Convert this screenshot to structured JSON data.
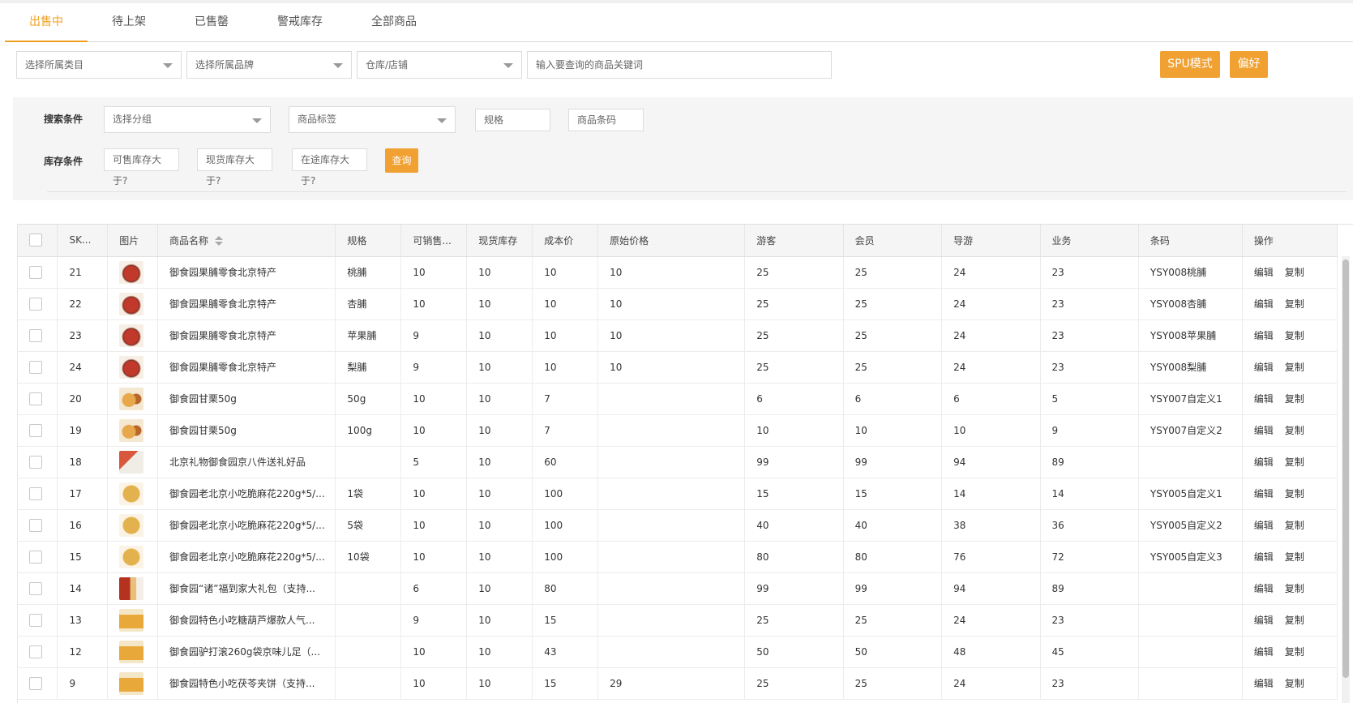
{
  "tabs": [
    {
      "label": "出售中",
      "active": true
    },
    {
      "label": "待上架",
      "active": false
    },
    {
      "label": "已售罄",
      "active": false
    },
    {
      "label": "警戒库存",
      "active": false
    },
    {
      "label": "全部商品",
      "active": false
    }
  ],
  "filters": {
    "category": "选择所属类目",
    "brand": "选择所属品牌",
    "warehouse": "仓库/店铺",
    "keyword_placeholder": "输入要查询的商品关键词"
  },
  "buttons": {
    "spu_mode": "SPU模式",
    "preference": "偏好",
    "query": "查询"
  },
  "search_conditions": {
    "label": "搜索条件",
    "group": "选择分组",
    "tag": "商品标签",
    "spec": "规格",
    "barcode": "商品条码"
  },
  "stock_conditions": {
    "label": "库存条件",
    "sellable": "可售库存大于?",
    "onhand": "现货库存大于?",
    "transit": "在途库存大于?"
  },
  "table": {
    "headers": [
      "SK...",
      "图片",
      "商品名称",
      "规格",
      "可销售...",
      "现货库存",
      "成本价",
      "原始价格",
      "游客",
      "会员",
      "导游",
      "业务",
      "条码",
      "操作"
    ],
    "row_actions": {
      "edit": "编辑",
      "copy": "复制"
    },
    "rows": [
      {
        "sku": "21",
        "img": "a",
        "name": "御食园果脯零食北京特产",
        "spec": "桃脯",
        "sellable": "10",
        "stock": "10",
        "cost": "10",
        "orig": "10",
        "guest": "25",
        "member": "25",
        "guide": "24",
        "biz": "23",
        "barcode": "YSY008桃脯"
      },
      {
        "sku": "22",
        "img": "a",
        "name": "御食园果脯零食北京特产",
        "spec": "杏脯",
        "sellable": "10",
        "stock": "10",
        "cost": "10",
        "orig": "10",
        "guest": "25",
        "member": "25",
        "guide": "24",
        "biz": "23",
        "barcode": "YSY008杏脯"
      },
      {
        "sku": "23",
        "img": "a",
        "name": "御食园果脯零食北京特产",
        "spec": "苹果脯",
        "sellable": "9",
        "stock": "10",
        "cost": "10",
        "orig": "10",
        "guest": "25",
        "member": "25",
        "guide": "24",
        "biz": "23",
        "barcode": "YSY008苹果脯"
      },
      {
        "sku": "24",
        "img": "a",
        "name": "御食园果脯零食北京特产",
        "spec": "梨脯",
        "sellable": "9",
        "stock": "10",
        "cost": "10",
        "orig": "10",
        "guest": "25",
        "member": "25",
        "guide": "24",
        "biz": "23",
        "barcode": "YSY008梨脯"
      },
      {
        "sku": "20",
        "img": "b",
        "name": "御食园甘栗50g",
        "spec": "50g",
        "sellable": "10",
        "stock": "10",
        "cost": "7",
        "orig": "",
        "guest": "6",
        "member": "6",
        "guide": "6",
        "biz": "5",
        "barcode": "YSY007自定义1"
      },
      {
        "sku": "19",
        "img": "b",
        "name": "御食园甘栗50g",
        "spec": "100g",
        "sellable": "10",
        "stock": "10",
        "cost": "7",
        "orig": "",
        "guest": "10",
        "member": "10",
        "guide": "10",
        "biz": "9",
        "barcode": "YSY007自定义2"
      },
      {
        "sku": "18",
        "img": "c",
        "name": "北京礼物御食园京八件送礼好品",
        "spec": "",
        "sellable": "5",
        "stock": "10",
        "cost": "60",
        "orig": "",
        "guest": "99",
        "member": "99",
        "guide": "94",
        "biz": "89",
        "barcode": ""
      },
      {
        "sku": "17",
        "img": "d",
        "name": "御食园老北京小吃脆麻花220g*5/...",
        "spec": "1袋",
        "sellable": "10",
        "stock": "10",
        "cost": "100",
        "orig": "",
        "guest": "15",
        "member": "15",
        "guide": "14",
        "biz": "14",
        "barcode": "YSY005自定义1"
      },
      {
        "sku": "16",
        "img": "d",
        "name": "御食园老北京小吃脆麻花220g*5/...",
        "spec": "5袋",
        "sellable": "10",
        "stock": "10",
        "cost": "100",
        "orig": "",
        "guest": "40",
        "member": "40",
        "guide": "38",
        "biz": "36",
        "barcode": "YSY005自定义2"
      },
      {
        "sku": "15",
        "img": "d",
        "name": "御食园老北京小吃脆麻花220g*5/...",
        "spec": "10袋",
        "sellable": "10",
        "stock": "10",
        "cost": "100",
        "orig": "",
        "guest": "80",
        "member": "80",
        "guide": "76",
        "biz": "72",
        "barcode": "YSY005自定义3"
      },
      {
        "sku": "14",
        "img": "e",
        "name": "御食园“诸”福到家大礼包（支持...",
        "spec": "",
        "sellable": "6",
        "stock": "10",
        "cost": "80",
        "orig": "",
        "guest": "99",
        "member": "99",
        "guide": "94",
        "biz": "89",
        "barcode": ""
      },
      {
        "sku": "13",
        "img": "f",
        "name": "御食园特色小吃糖葫芦爆款人气...",
        "spec": "",
        "sellable": "9",
        "stock": "10",
        "cost": "15",
        "orig": "",
        "guest": "25",
        "member": "25",
        "guide": "24",
        "biz": "23",
        "barcode": ""
      },
      {
        "sku": "12",
        "img": "f",
        "name": "御食园驴打滚260g袋京味儿足（...",
        "spec": "",
        "sellable": "10",
        "stock": "10",
        "cost": "43",
        "orig": "",
        "guest": "50",
        "member": "50",
        "guide": "48",
        "biz": "45",
        "barcode": ""
      },
      {
        "sku": "9",
        "img": "f",
        "name": "御食园特色小吃茯苓夹饼（支持...",
        "spec": "",
        "sellable": "10",
        "stock": "10",
        "cost": "15",
        "orig": "29",
        "guest": "25",
        "member": "25",
        "guide": "24",
        "biz": "23",
        "barcode": ""
      }
    ]
  }
}
